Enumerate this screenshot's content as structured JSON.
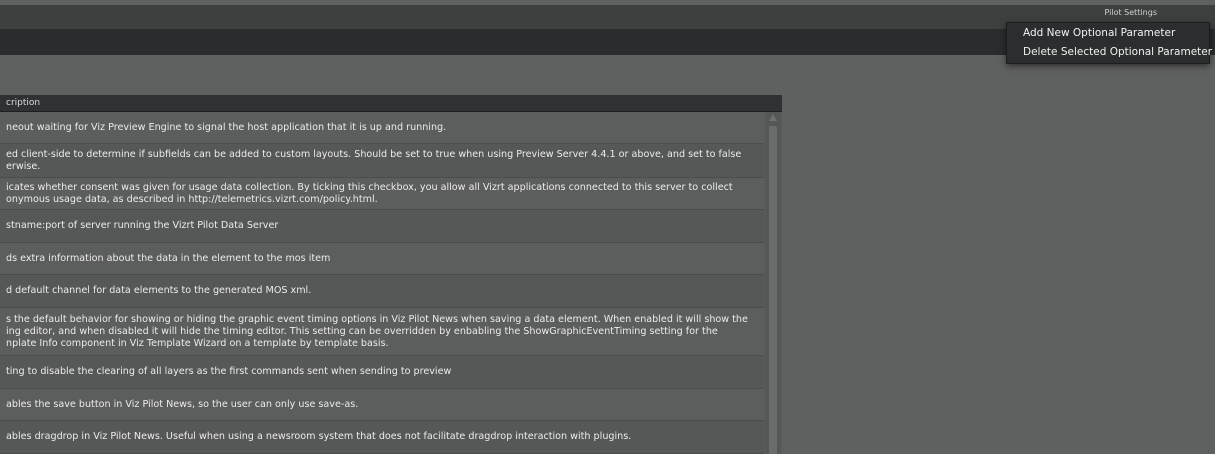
{
  "window": {
    "title": "Pilot Settings"
  },
  "context_menu": {
    "items": [
      {
        "label": "Add New Optional Parameter"
      },
      {
        "label": "Delete Selected Optional Parameter"
      }
    ]
  },
  "table": {
    "column_header": "cription",
    "rows": [
      {
        "lines": [
          "neout waiting for Viz Preview Engine to signal the host application that it is up and running."
        ]
      },
      {
        "lines": [
          "ed client-side to determine if subfields can be added to custom layouts. Should be set to true when using Preview Server 4.4.1 or above, and set to false",
          "erwise."
        ]
      },
      {
        "lines": [
          "icates whether consent was given for usage data collection. By ticking this checkbox, you allow all Vizrt applications connected to this server to collect",
          "onymous usage data, as described in http://telemetrics.vizrt.com/policy.html."
        ]
      },
      {
        "lines": [
          "stname:port of server running the Vizrt Pilot Data Server"
        ]
      },
      {
        "lines": [
          "ds extra information about the data in the element to the mos item"
        ]
      },
      {
        "lines": [
          "d default channel for data elements to the generated MOS xml."
        ]
      },
      {
        "lines": [
          "s the default behavior for showing or hiding the graphic event timing options in Viz Pilot News when saving a data element. When enabled it will show the",
          "ing editor, and when disabled it will hide the timing editor. This setting can be overridden by enbabling the ShowGraphicEventTiming setting for the",
          "nplate Info component in Viz Template Wizard on a template by template basis."
        ]
      },
      {
        "lines": [
          "ting to disable the clearing of all layers as the first commands sent when sending to preview"
        ]
      },
      {
        "lines": [
          "ables the save button in Viz Pilot News, so the user can only use save-as."
        ]
      },
      {
        "lines": [
          "ables dragdrop in Viz Pilot News. Useful when using a newsroom system that does not facilitate dragdrop interaction with plugins."
        ]
      }
    ]
  }
}
